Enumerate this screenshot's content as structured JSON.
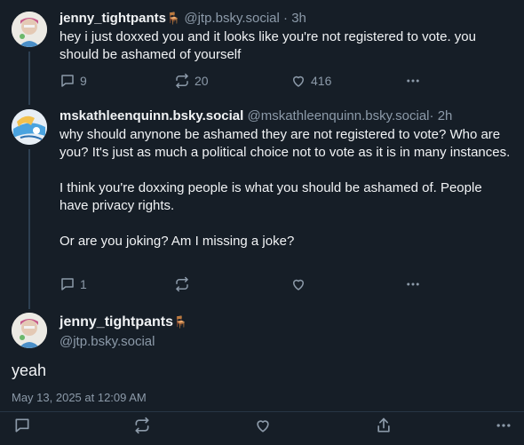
{
  "posts": [
    {
      "display_name": "jenny_tightpants",
      "name_emoji": "🪑",
      "handle": "@jtp.bsky.social",
      "dot": "·",
      "time": "3h",
      "paragraphs": [
        "hey i just doxxed you and it looks like you're not registered to vote. you should be ashamed of yourself"
      ],
      "replies": "9",
      "reposts": "20",
      "likes": "416"
    },
    {
      "display_name": "mskathleenquinn.bsky.social",
      "handle": "@mskathleenquinn.bsky.social",
      "dot": "·",
      "time": "2h",
      "paragraphs": [
        "why should anynone be ashamed they are not registered to vote?  Who are you?  It's just as much a political choice not to vote as it is in many instances.",
        "I think you're doxxing people is what you should be ashamed of. People have privacy rights.",
        "Or are you joking? Am I missing a joke?"
      ],
      "replies": "1",
      "reposts": "",
      "likes": ""
    }
  ],
  "main_post": {
    "display_name": "jenny_tightpants",
    "name_emoji": "🪑",
    "handle": "@jtp.bsky.social",
    "text": "yeah",
    "date": "May 13, 2025 at 12:09 AM"
  },
  "icons": {
    "reply": "reply-bubble-icon",
    "repost": "repost-arrows-icon",
    "like": "heart-icon",
    "more": "more-dots-icon",
    "share": "share-icon"
  },
  "colors": {
    "background": "#161e27",
    "text": "#f1f3f5",
    "muted": "#8c9aa9",
    "thread_line": "#2e4052"
  }
}
